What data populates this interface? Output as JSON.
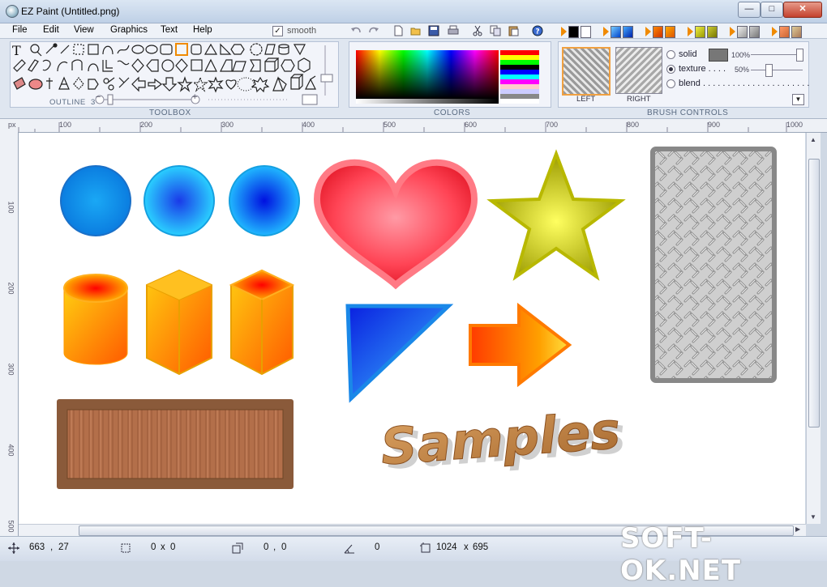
{
  "window": {
    "title": "EZ Paint (Untitled.png)",
    "minimize": "—",
    "maximize": "□",
    "close": "✕"
  },
  "menu": [
    "File",
    "Edit",
    "View",
    "Graphics",
    "Text",
    "Help"
  ],
  "toolbar": {
    "smooth_label": "smooth",
    "smooth_checked": true,
    "check_mark": "✓"
  },
  "ribbon": {
    "toolbox_label": "TOOLBOX",
    "colors_label": "COLORS",
    "brush_controls_label": "BRUSH CONTROLS",
    "outline_label": "OUTLINE",
    "outline_value": "3",
    "minus": "−",
    "plus": "+",
    "left_label": "LEFT",
    "right_label": "RIGHT",
    "brush_options": {
      "solid": "solid",
      "texture": "texture . . . .",
      "blend": "blend . . . . . . . . . . . . . . . . . . . . . ."
    },
    "selected_brush": "texture",
    "solid_percent": "100%",
    "texture_percent": "50%"
  },
  "ruler": {
    "unit": "px",
    "top_ticks": [
      "100",
      "200",
      "300",
      "400",
      "500",
      "600",
      "700",
      "800",
      "900",
      "1000"
    ],
    "left_ticks": [
      "100",
      "200",
      "300",
      "400",
      "500"
    ]
  },
  "canvas": {
    "sample_text": "Samples"
  },
  "status": {
    "cursor_x": "663",
    "cursor_y": "27",
    "sep1": ",",
    "selection_w": "0",
    "selection_h": "0",
    "times1": "x",
    "offset_x": "0",
    "offset_y": "0",
    "sep2": ",",
    "angle": "0",
    "image_w": "1024",
    "image_h": "695",
    "times2": "x"
  },
  "watermark": "SOFT-OK.NET",
  "colors": {
    "accent": "#f08a00",
    "title_gradient_top": "#dbe6f3"
  }
}
